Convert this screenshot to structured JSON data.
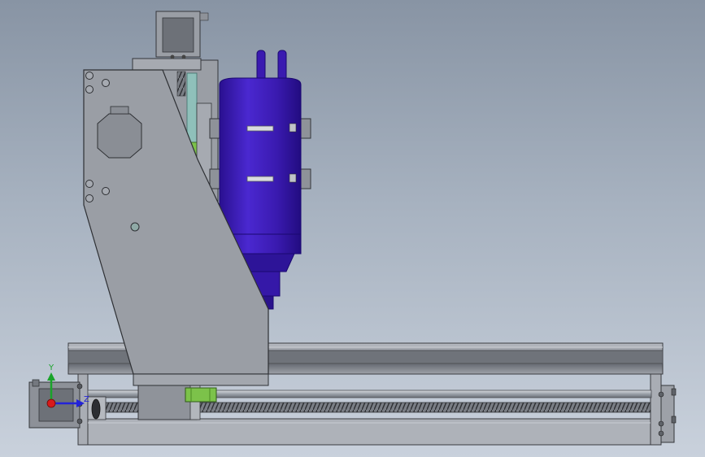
{
  "triad": {
    "y_label": "Y",
    "z_label": "Z",
    "y_color": "#1aa32a",
    "z_color": "#2323d8",
    "x_color": "#d81a1a"
  },
  "colors": {
    "background_top": "#8894a4",
    "background_bottom": "#c9d1dc",
    "frame": "#9ea2aa",
    "frame_dark": "#4a4d52",
    "spindle": "#3a1ab0",
    "spindle_dark": "#24108a",
    "linear_block": "#7cc24a",
    "guide_rod": "#7fb3ad"
  }
}
